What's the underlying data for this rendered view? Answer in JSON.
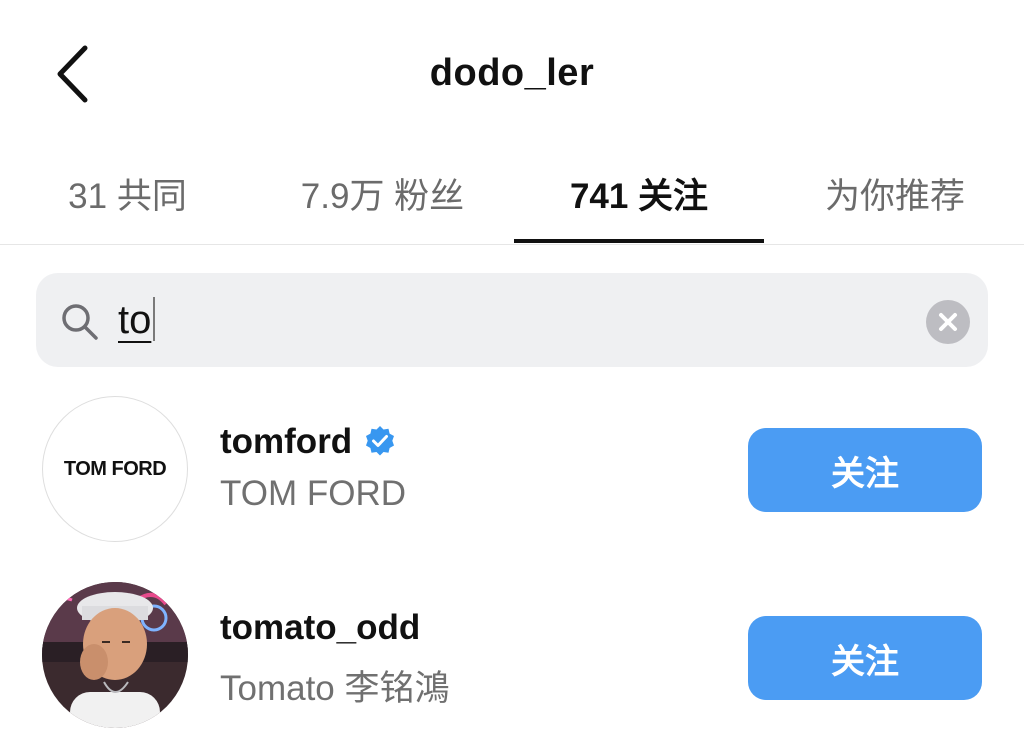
{
  "header": {
    "title": "dodo_ler",
    "back_icon": "chevron-left-icon"
  },
  "tabs": [
    {
      "label": "31 共同",
      "active": false
    },
    {
      "label": "7.9万 粉丝",
      "active": false
    },
    {
      "label": "741 关注",
      "active": true
    },
    {
      "label": "为你推荐",
      "active": false
    }
  ],
  "search": {
    "value": "to",
    "search_icon": "search-icon",
    "clear_icon": "clear-icon"
  },
  "users": [
    {
      "username": "tomford",
      "full_name": "TOM FORD",
      "verified": true,
      "avatar_logo_text": "TOM FORD",
      "follow_label": "关注"
    },
    {
      "username": "tomato_odd",
      "full_name": "Tomato 李铭鴻",
      "verified": false,
      "follow_label": "关注"
    }
  ],
  "colors": {
    "accent": "#4b9cf3",
    "verified": "#3897f0",
    "muted_text": "#707070",
    "search_bg": "#eff0f2"
  }
}
